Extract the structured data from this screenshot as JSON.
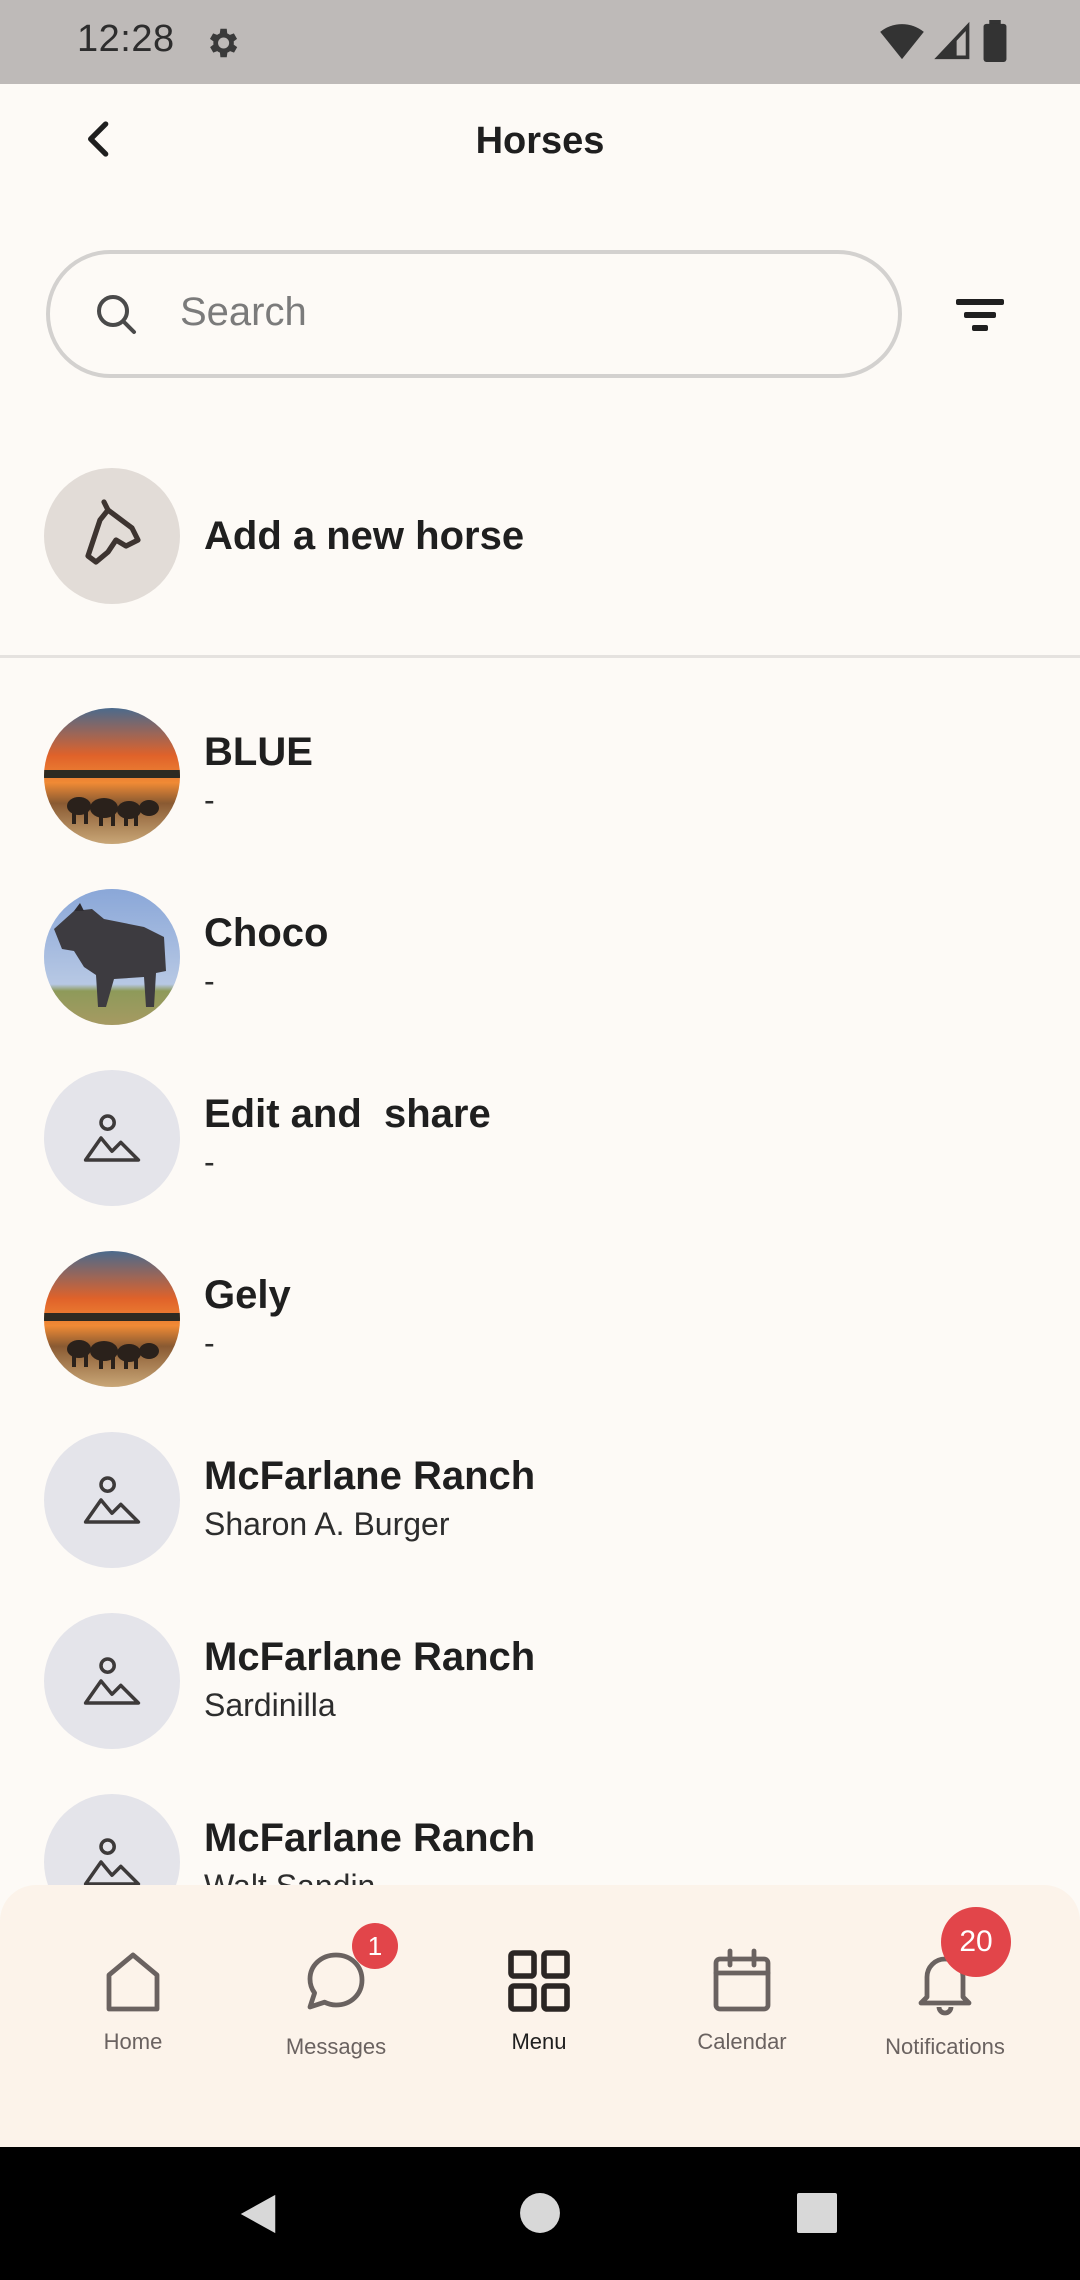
{
  "status_bar": {
    "time": "12:28"
  },
  "header": {
    "title": "Horses"
  },
  "search": {
    "placeholder": "Search"
  },
  "add_horse": {
    "label": "Add a new horse"
  },
  "horses": [
    {
      "name": "BLUE",
      "subtitle": "-",
      "photo": "sunset-elephants"
    },
    {
      "name": "Choco",
      "subtitle": "-",
      "photo": "grey-horse"
    },
    {
      "name": "Edit and  share",
      "subtitle": "-",
      "photo": "placeholder"
    },
    {
      "name": "Gely",
      "subtitle": "-",
      "photo": "sunset-elephants"
    },
    {
      "name": "McFarlane Ranch",
      "subtitle": "Sharon A. Burger",
      "photo": "placeholder"
    },
    {
      "name": "McFarlane Ranch",
      "subtitle": "Sardinilla",
      "photo": "placeholder"
    },
    {
      "name": "McFarlane Ranch",
      "subtitle": "Walt Sandin",
      "photo": "placeholder"
    }
  ],
  "bottom_nav": {
    "items": [
      {
        "label": "Home",
        "icon": "home-icon"
      },
      {
        "label": "Messages",
        "icon": "chat-icon",
        "badge": "1"
      },
      {
        "label": "Menu",
        "icon": "grid-icon",
        "active": true
      },
      {
        "label": "Calendar",
        "icon": "calendar-icon"
      },
      {
        "label": "Notifications",
        "icon": "bell-icon",
        "badge": "20"
      }
    ]
  },
  "colors": {
    "background": "#fdfaf6",
    "status_bar": "#bebab8",
    "nav_background": "#fcf3ea",
    "badge": "#e2454a",
    "avatar_placeholder": "#e4e4ea"
  }
}
